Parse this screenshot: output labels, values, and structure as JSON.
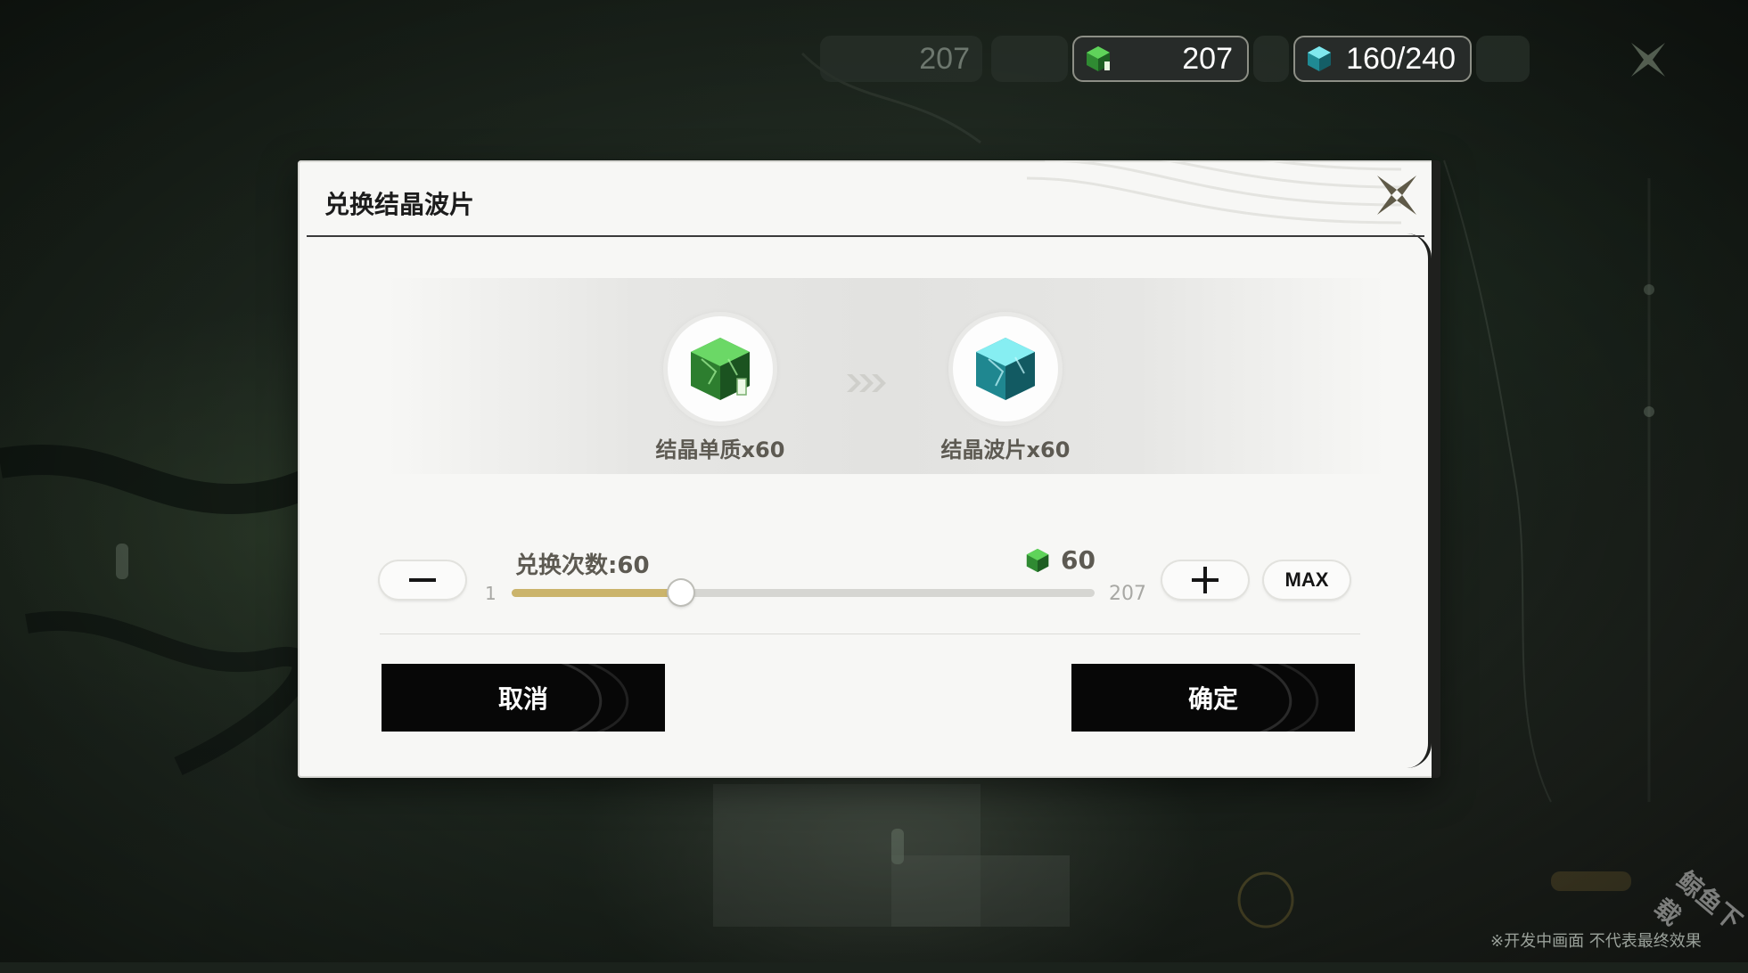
{
  "hud": {
    "dim_value": "207",
    "monomer_count": "207",
    "waveplate_count": "160/240"
  },
  "dialog": {
    "title": "兑换结晶波片",
    "source_item": {
      "name": "结晶单质x60",
      "icon": "green-crystal-icon"
    },
    "target_item": {
      "name": "结晶波片x60",
      "icon": "cyan-crystal-icon"
    },
    "exchange_label": "兑换次数:60",
    "cost_value": "60",
    "slider": {
      "min": "1",
      "max": "207",
      "value": 60,
      "fraction": 0.29
    },
    "minus_label": "−",
    "plus_label": "+",
    "max_label": "MAX",
    "cancel_label": "取消",
    "confirm_label": "确定"
  },
  "footer_note": "※开发中画面 不代表最终效果",
  "watermark": "鲸鱼下载",
  "colors": {
    "slider_fill": "#cbb46b",
    "button_bg": "#070707",
    "dialog_bg": "#f7f7f5"
  }
}
